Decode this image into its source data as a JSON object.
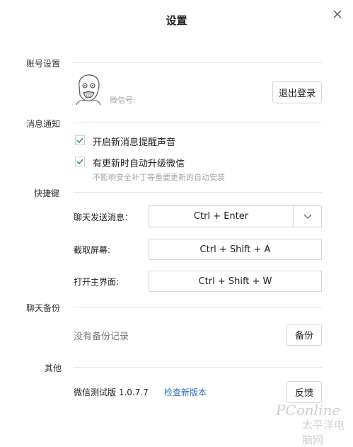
{
  "title": "设置",
  "account": {
    "section_label": "账号设置",
    "wechat_id_label": "微信号:",
    "logout_button": "退出登录"
  },
  "notifications": {
    "section_label": "消息通知",
    "options": [
      {
        "label": "开启新消息提醒声音",
        "checked": true
      },
      {
        "label": "有更新时自动升级微信",
        "checked": true
      }
    ],
    "hint": "不影响安全补丁等重要更新的自动安装"
  },
  "shortcuts": {
    "section_label": "快捷键",
    "rows": [
      {
        "label": "聊天发送消息：",
        "value": "Ctrl + Enter"
      },
      {
        "label": "截取屏幕:",
        "value": "Ctrl + Shift + A"
      },
      {
        "label": "打开主界面:",
        "value": "Ctrl + Shift + W"
      }
    ]
  },
  "backup": {
    "section_label": "聊天备份",
    "status": "没有备份记录",
    "button": "备份"
  },
  "other": {
    "section_label": "其他",
    "version": "微信测试版 1.0.7.7",
    "check_update": "检查新版本",
    "feedback_button": "反馈"
  },
  "watermark": {
    "line1": "PConline",
    "line2": "太平洋电脑网"
  },
  "colors": {
    "check": "#3fa043",
    "link": "#2f6fb6"
  }
}
